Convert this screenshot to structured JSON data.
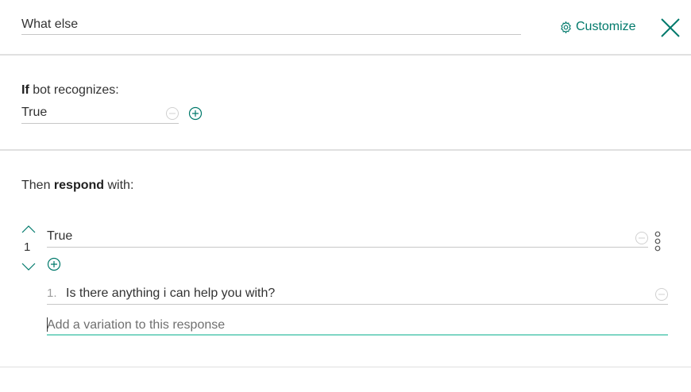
{
  "header": {
    "node_name": "What else",
    "customize_label": "Customize"
  },
  "condition": {
    "label_bold": "If",
    "label_rest": " bot recognizes:",
    "value": "True"
  },
  "response": {
    "label_prefix": "Then ",
    "label_bold": "respond",
    "label_suffix": " with:",
    "index": "1",
    "condition_value": "True",
    "variations": [
      {
        "number": "1.",
        "text": "Is there anything i can help you with?"
      }
    ],
    "add_variation_placeholder": "Add a variation to this response"
  },
  "colors": {
    "accent": "#00796b",
    "focus_underline": "#7fd6c4",
    "muted_icon": "#c7c7c7",
    "divider": "#e0e0e0"
  },
  "icons": {
    "customize": "gear-icon",
    "close": "close-icon",
    "remove": "minus-circle-icon",
    "add": "plus-circle-icon",
    "move_up": "chevron-up-icon",
    "move_down": "chevron-down-icon",
    "more": "kebab-menu-icon"
  }
}
